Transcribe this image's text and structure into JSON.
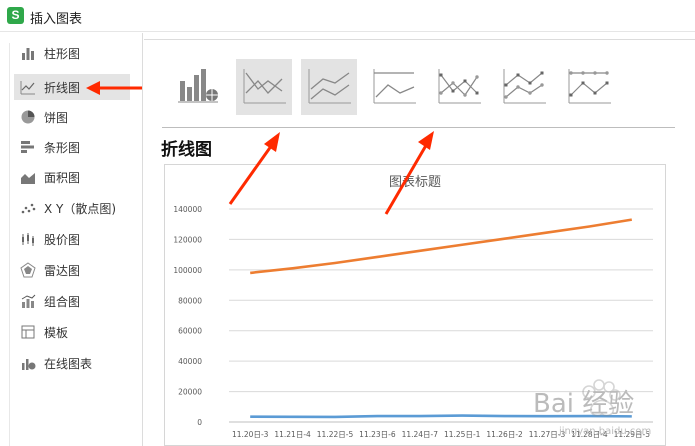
{
  "window": {
    "title": "插入图表",
    "app_icon": "S"
  },
  "sidebar": {
    "items": [
      {
        "label": "柱形图",
        "icon": "bar-chart-icon"
      },
      {
        "label": "折线图",
        "icon": "line-chart-icon",
        "active": true
      },
      {
        "label": "饼图",
        "icon": "pie-chart-icon"
      },
      {
        "label": "条形图",
        "icon": "horizontal-bar-icon"
      },
      {
        "label": "面积图",
        "icon": "area-chart-icon"
      },
      {
        "label": "X Y（散点图)",
        "icon": "scatter-icon"
      },
      {
        "label": "股价图",
        "icon": "stock-chart-icon"
      },
      {
        "label": "雷达图",
        "icon": "radar-icon"
      },
      {
        "label": "组合图",
        "icon": "combo-chart-icon"
      },
      {
        "label": "模板",
        "icon": "template-icon"
      },
      {
        "label": "在线图表",
        "icon": "online-chart-icon"
      }
    ]
  },
  "main": {
    "section_title": "折线图",
    "subtypes": [
      {
        "icon": "online-line-chart-icon"
      },
      {
        "icon": "line-chart-icon",
        "selected": true
      },
      {
        "icon": "stacked-line-chart-icon",
        "selected": true
      },
      {
        "icon": "percent-stacked-line-icon"
      },
      {
        "icon": "line-with-markers-icon"
      },
      {
        "icon": "stacked-line-markers-icon"
      },
      {
        "icon": "percent-stacked-line-markers-icon"
      }
    ]
  },
  "chart_data": {
    "type": "line",
    "title": "图表标题",
    "categories": [
      "11.20日-3",
      "11.21日-4",
      "11.22日-5",
      "11.23日-6",
      "11.24日-7",
      "11.25日-1",
      "11.26日-2",
      "11.27日-3",
      "11.28日-4",
      "11.29日-5"
    ],
    "yticks": [
      "0",
      "20000",
      "40000",
      "60000",
      "80000",
      "100000",
      "120000",
      "140000"
    ],
    "ylim": [
      0,
      140000
    ],
    "grid": true,
    "series": [
      {
        "color": "#ed7d31",
        "values": [
          98000,
          101000,
          104500,
          108500,
          112500,
          116500,
          120500,
          124500,
          128500,
          133000
        ]
      },
      {
        "color": "#5b9bd5",
        "values": [
          3500,
          3400,
          3300,
          3900,
          3900,
          4200,
          3900,
          3800,
          3900,
          3700
        ]
      }
    ]
  },
  "annotations": {
    "arrow_color": "#ff2a00"
  },
  "watermark": {
    "text": "Bai 经验",
    "sub": "jingyan.baidu.com"
  },
  "colors": {
    "accent": "#2fa84a",
    "selected_bg": "#e3e3e3"
  }
}
